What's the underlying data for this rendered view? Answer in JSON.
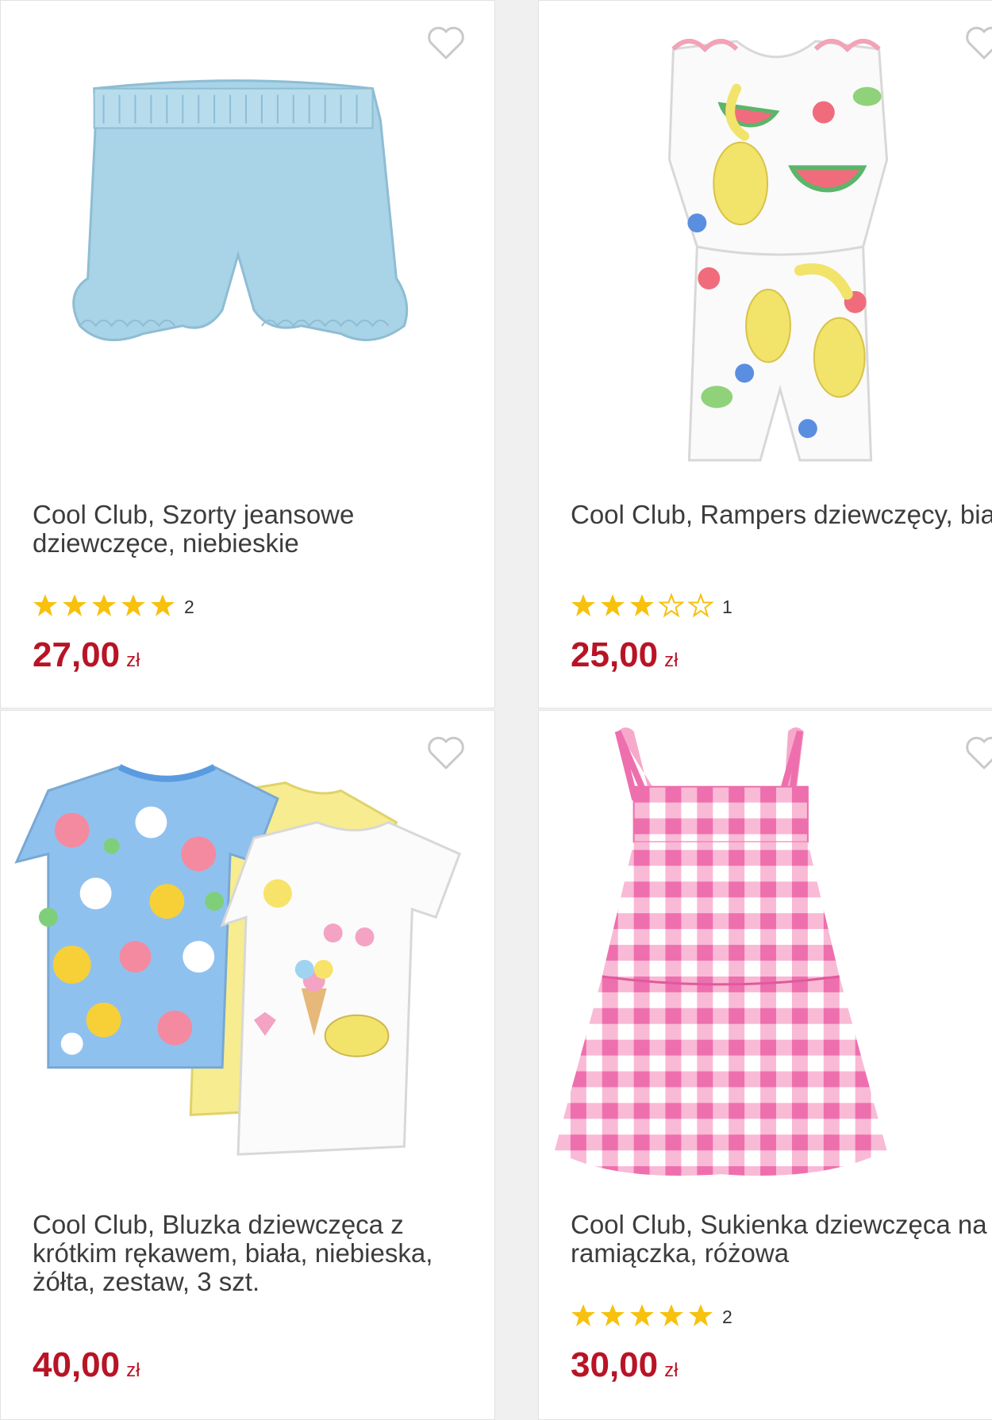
{
  "colors": {
    "price": "#b81426",
    "star": "#f7c10d",
    "title": "#3c3c3c",
    "heart_outline": "#c9c9c9"
  },
  "products": [
    {
      "title": "Cool Club, Szorty jeansowe dziewczęce, niebieskie",
      "rating_stars": 5,
      "rating_count": "2",
      "price_amount": "27,00",
      "price_currency": "zł",
      "image": "denim-shorts"
    },
    {
      "title": "Cool Club, Rampers dziewczęcy, biały",
      "rating_stars": 3,
      "rating_count": "1",
      "price_amount": "25,00",
      "price_currency": "zł",
      "image": "fruit-romper"
    },
    {
      "title": "Cool Club, Bluzka dziewczęca z krótkim rękawem, biała, niebieska, żółta, zestaw, 3 szt.",
      "price_amount": "40,00",
      "price_currency": "zł",
      "image": "tshirt-set"
    },
    {
      "title": "Cool Club, Sukienka dziewczęca na ramiączka, różowa",
      "rating_stars": 5,
      "rating_count": "2",
      "price_amount": "30,00",
      "price_currency": "zł",
      "image": "gingham-dress"
    }
  ]
}
